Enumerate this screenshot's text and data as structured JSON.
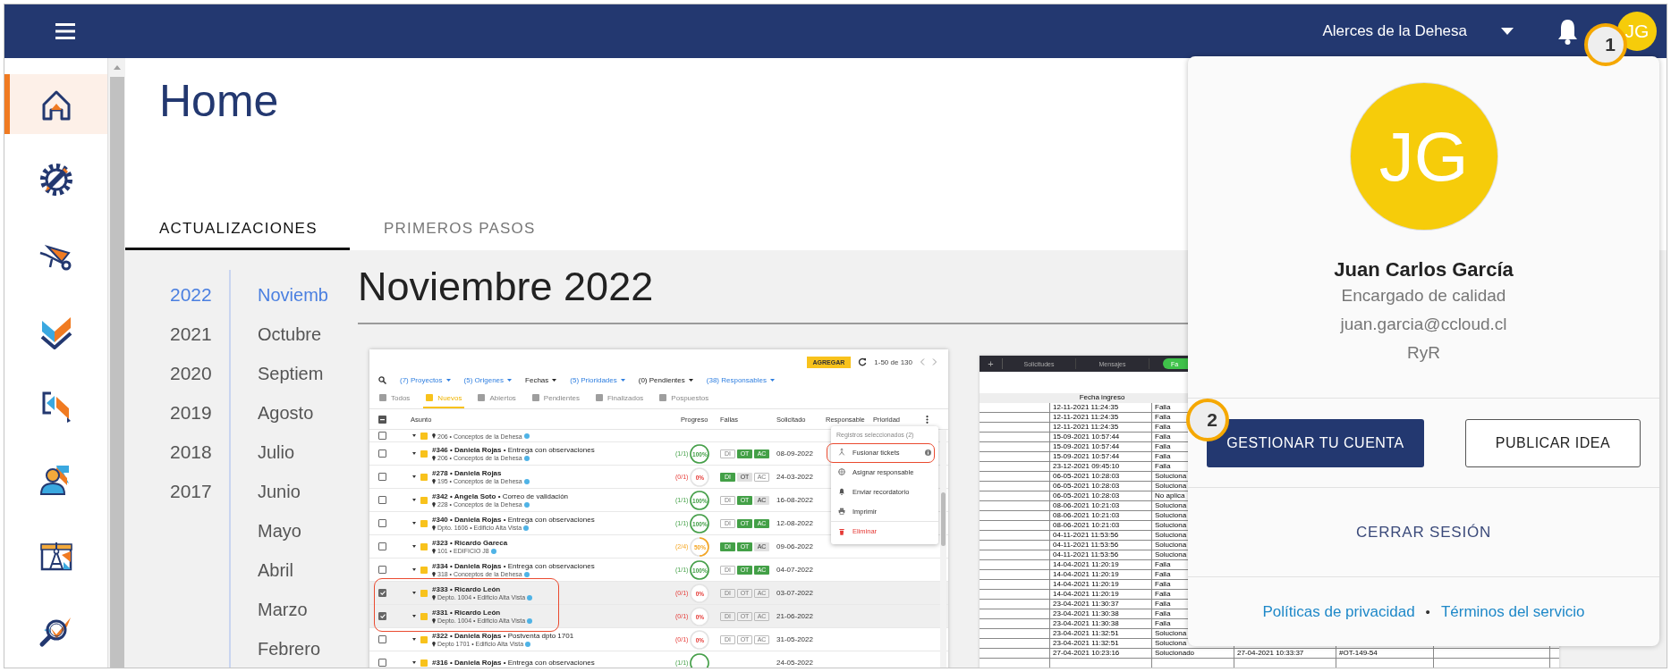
{
  "topbar": {
    "project": "Alerces de la Dehesa",
    "avatar": "JG"
  },
  "sidebar": {
    "items": [
      {
        "selected": true
      },
      {
        "selected": false
      },
      {
        "selected": false
      },
      {
        "selected": false
      },
      {
        "selected": false
      },
      {
        "selected": false
      },
      {
        "selected": false
      },
      {
        "selected": false
      }
    ]
  },
  "page": {
    "title": "Home"
  },
  "tabs": [
    {
      "label": "ACTUALIZACIONES",
      "selected": true
    },
    {
      "label": "PRIMEROS PASOS",
      "selected": false
    }
  ],
  "years": [
    {
      "label": "2022",
      "selected": true
    },
    {
      "label": "2021",
      "selected": false
    },
    {
      "label": "2020",
      "selected": false
    },
    {
      "label": "2019",
      "selected": false
    },
    {
      "label": "2018",
      "selected": false
    },
    {
      "label": "2017",
      "selected": false
    }
  ],
  "months": [
    {
      "label": "Noviemb",
      "selected": true
    },
    {
      "label": "Octubre",
      "selected": false
    },
    {
      "label": "Septiem",
      "selected": false
    },
    {
      "label": "Agosto",
      "selected": false
    },
    {
      "label": "Julio",
      "selected": false
    },
    {
      "label": "Junio",
      "selected": false
    },
    {
      "label": "Mayo",
      "selected": false
    },
    {
      "label": "Abril",
      "selected": false
    },
    {
      "label": "Marzo",
      "selected": false
    },
    {
      "label": "Febrero",
      "selected": false
    }
  ],
  "section": {
    "title": "Noviembre 2022"
  },
  "ticket_screenshot": {
    "add_button": "AGREGAR",
    "pagination": "1-50 de 130",
    "filters": [
      {
        "label": "(7) Proyectos",
        "active": true
      },
      {
        "label": "(5) Origenes",
        "active": true
      },
      {
        "label": "Fechas",
        "active": false
      },
      {
        "label": "(5) Prioridades",
        "active": true
      },
      {
        "label": "(0) Pendientes",
        "active": false
      },
      {
        "label": "(38) Responsables",
        "active": true
      }
    ],
    "tabs": [
      {
        "label": "Todos",
        "selected": false
      },
      {
        "label": "Nuevos",
        "selected": true
      },
      {
        "label": "Abiertos",
        "selected": false
      },
      {
        "label": "Pendientes",
        "selected": false
      },
      {
        "label": "Finalizados",
        "selected": false
      },
      {
        "label": "Pospuestos",
        "selected": false
      }
    ],
    "columns": [
      "Asunto",
      "Progreso",
      "Fallas",
      "Solicitado",
      "Responsable",
      "Prioridad"
    ],
    "rows": [
      {
        "subtitle": "206 • Conceptos de la Dehesa",
        "checked": false,
        "highlighted": false
      },
      {
        "title": "**#346 • Daniela Rojas** • Entrega con observaciones",
        "subtitle": "206 • Conceptos de la Dehesa",
        "progress": "(1/1)",
        "percent": "100%",
        "level": 1,
        "faults": [
          {
            "label": "DI",
            "kind": "empty"
          },
          {
            "label": "OT",
            "kind": "done"
          },
          {
            "label": "AC",
            "kind": "done"
          }
        ],
        "date": "08-09-2022",
        "checked": false,
        "highlighted": false
      },
      {
        "title": "**#278 • Daniela Rojas**",
        "subtitle": "195 • Conceptos de la Dehesa",
        "progress": "(0/1)",
        "percent": "0%",
        "level": 0,
        "faults": [
          {
            "label": "DI",
            "kind": "done"
          },
          {
            "label": "OT",
            "kind": "pending"
          },
          {
            "label": "AC",
            "kind": "empty"
          }
        ],
        "date": "24-03-2022",
        "checked": false,
        "highlighted": false
      },
      {
        "title": "**#342 • Angela Soto** • Correo de validación",
        "subtitle": "228 • Conceptos de la Dehesa",
        "progress": "(1/1)",
        "percent": "100%",
        "level": 1,
        "faults": [
          {
            "label": "DI",
            "kind": "empty"
          },
          {
            "label": "OT",
            "kind": "done"
          },
          {
            "label": "AC",
            "kind": "pending"
          }
        ],
        "date": "16-08-2022",
        "checked": false,
        "highlighted": false
      },
      {
        "title": "**#340 • Daniela Rojas** • Entrega con observaciones",
        "subtitle": "Dpto. 1606 • Edificio Alta Vista",
        "progress": "(1/1)",
        "percent": "100%",
        "level": 1,
        "faults": [
          {
            "label": "DI",
            "kind": "empty"
          },
          {
            "label": "OT",
            "kind": "done"
          },
          {
            "label": "AC",
            "kind": "done"
          }
        ],
        "date": "12-08-2022",
        "checked": false,
        "highlighted": false
      },
      {
        "title": "**#323 • Ricardo Gareca**",
        "subtitle": "101 • EDIFICIO J8",
        "progress": "(2/4)",
        "percent": "50%",
        "level": 0.5,
        "faults": [
          {
            "label": "DI",
            "kind": "done"
          },
          {
            "label": "OT",
            "kind": "done"
          },
          {
            "label": "AC",
            "kind": "pending"
          }
        ],
        "date": "09-06-2022",
        "checked": false,
        "highlighted": false
      },
      {
        "title": "**#334 • Daniela Rojas** • Entrega con observaciones",
        "subtitle": "318 • Conceptos de la Dehesa",
        "progress": "(1/1)",
        "percent": "100%",
        "level": 1,
        "faults": [
          {
            "label": "DI",
            "kind": "empty"
          },
          {
            "label": "OT",
            "kind": "done"
          },
          {
            "label": "AC",
            "kind": "done"
          }
        ],
        "date": "04-07-2022",
        "checked": false,
        "highlighted": false
      },
      {
        "title": "**#333 • Ricardo León**",
        "subtitle": "Depto. 1004 • Edificio Alta Vista",
        "progress": "(0/1)",
        "percent": "0%",
        "level": 0,
        "faults": [
          {
            "label": "DI",
            "kind": "empty"
          },
          {
            "label": "OT",
            "kind": "empty"
          },
          {
            "label": "AC",
            "kind": "empty"
          }
        ],
        "date": "03-07-2022",
        "checked": true,
        "highlighted": true
      },
      {
        "title": "**#331 • Ricardo León**",
        "subtitle": "Depto. 1004 • Edificio Alta Vista",
        "progress": "(0/1)",
        "percent": "0%",
        "level": 0,
        "faults": [
          {
            "label": "DI",
            "kind": "empty"
          },
          {
            "label": "OT",
            "kind": "empty"
          },
          {
            "label": "AC",
            "kind": "empty"
          }
        ],
        "date": "21-06-2022",
        "checked": true,
        "highlighted": true
      },
      {
        "title": "**#322 • Daniela Rojas** • Postventa dpto 1701",
        "subtitle": "Depto 1701 • Edificio Alta Vista",
        "progress": "(0/1)",
        "percent": "0%",
        "level": 0,
        "faults": [
          {
            "label": "DI",
            "kind": "empty"
          },
          {
            "label": "OT",
            "kind": "empty"
          },
          {
            "label": "AC",
            "kind": "empty"
          }
        ],
        "date": "31-05-2022",
        "checked": false,
        "highlighted": false
      },
      {
        "title": "**#316 • Daniela Rojas** • Entrega con observaciones",
        "progress": "(1/1)",
        "level": 1,
        "date": "24-05-2022",
        "checked": false,
        "highlighted": false
      }
    ],
    "menu": {
      "header": "Registros seleccionados (2)",
      "items": [
        {
          "label": "Fusionar tickets",
          "kind": "normal",
          "highlighted": true
        },
        {
          "label": "Asignar responsable",
          "kind": "normal",
          "highlighted": false
        },
        {
          "label": "Enviar recordatorio",
          "kind": "normal",
          "highlighted": false
        },
        {
          "label": "Imprimir",
          "kind": "normal",
          "highlighted": false
        },
        {
          "label": "Eliminar",
          "kind": "danger",
          "highlighted": false
        }
      ]
    }
  },
  "sheet_screenshot": {
    "add_tab": "+",
    "tabs": [
      {
        "label": "Solicitudes",
        "selected": false
      },
      {
        "label": "Mensajes",
        "selected": false
      },
      {
        "label": "Fa",
        "selected": true
      }
    ],
    "header": "Fecha ingreso",
    "rows": [
      [
        "12-11-2021 11:24:35",
        "Falla"
      ],
      [
        "12-11-2021 11:24:35",
        "Falla"
      ],
      [
        "12-11-2021 11:24:35",
        "Falla"
      ],
      [
        "15-09-2021 10:57:44",
        "Falla"
      ],
      [
        "15-09-2021 10:57:44",
        "Falla"
      ],
      [
        "15-09-2021 10:57:44",
        "Falla"
      ],
      [
        "23-12-2021 09:45:10",
        "Falla"
      ],
      [
        "06-05-2021 10:28:03",
        "Soluciona"
      ],
      [
        "06-05-2021 10:28:03",
        "Soluciona"
      ],
      [
        "06-05-2021 10:28:03",
        "No aplica"
      ],
      [
        "08-06-2021 10:21:03",
        "Soluciona"
      ],
      [
        "08-06-2021 10:21:03",
        "Soluciona"
      ],
      [
        "08-06-2021 10:21:03",
        "Soluciona"
      ],
      [
        "04-11-2021 11:53:56",
        "Soluciona"
      ],
      [
        "04-11-2021 11:53:56",
        "Soluciona"
      ],
      [
        "04-11-2021 11:53:56",
        "Soluciona"
      ],
      [
        "14-04-2021 11:20:19",
        "Falla"
      ],
      [
        "14-04-2021 11:20:19",
        "Falla"
      ],
      [
        "14-04-2021 11:20:19",
        "Falla"
      ],
      [
        "14-04-2021 11:20:19",
        "Falla"
      ],
      [
        "23-04-2021 11:30:37",
        "Falla"
      ],
      [
        "23-04-2021 11:30:38",
        "Falla"
      ],
      [
        "23-04-2021 11:30:38",
        "Falla"
      ],
      [
        "23-04-2021 11:32:51",
        "Soluciona"
      ],
      [
        "23-04-2021 11:32:51",
        "Soluciona"
      ],
      [
        "27-04-2021 10:23:16",
        "Solucionado",
        "27-04-2021 10:33:37",
        "#OT-149-54"
      ]
    ]
  },
  "account_menu": {
    "avatar": "JG",
    "name": "Juan Carlos García",
    "role": "Encargado de calidad",
    "email": "juan.garcia@ccloud.cl",
    "company": "RyR",
    "primary_button": "GESTIONAR TU CUENTA",
    "secondary_button": "PUBLICAR IDEA",
    "logout": "CERRAR SESIÓN",
    "links": [
      "Políticas de privacidad",
      "Términos del servicio"
    ],
    "separator": "•"
  },
  "callouts": [
    {
      "label": "1"
    },
    {
      "label": "2"
    }
  ]
}
